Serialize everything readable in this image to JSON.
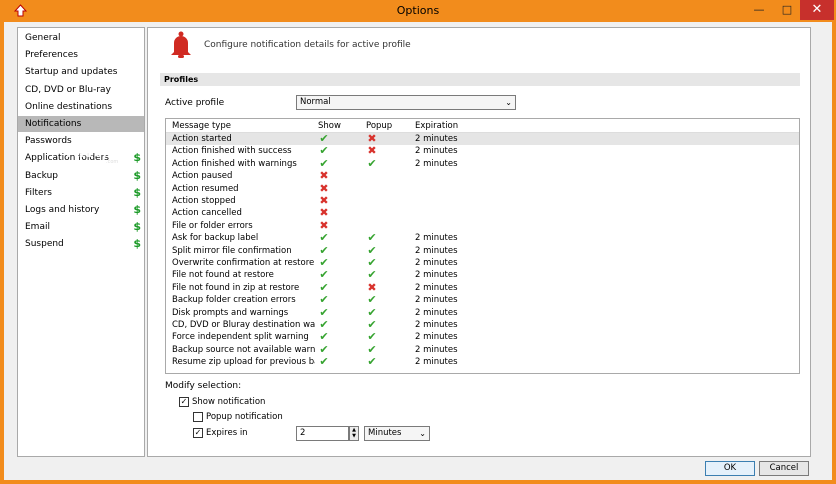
{
  "window": {
    "title": "Options",
    "min_icon": "minimize-icon",
    "max_icon": "maximize-icon",
    "close_icon": "close-icon"
  },
  "sidebar": {
    "items": [
      {
        "label": "General",
        "pro": false
      },
      {
        "label": "Preferences",
        "pro": false
      },
      {
        "label": "Startup and updates",
        "pro": false
      },
      {
        "label": "CD, DVD or Blu-ray",
        "pro": false
      },
      {
        "label": "Online destinations",
        "pro": false
      },
      {
        "label": "Notifications",
        "pro": false,
        "active": true
      },
      {
        "label": "Passwords",
        "pro": false
      },
      {
        "label": "Application folders",
        "pro": true
      },
      {
        "label": "Backup",
        "pro": true
      },
      {
        "label": "Filters",
        "pro": true
      },
      {
        "label": "Logs and history",
        "pro": true
      },
      {
        "label": "Email",
        "pro": true
      },
      {
        "label": "Suspend",
        "pro": true
      }
    ],
    "pro_marker": "$",
    "watermark": "FILECR",
    "watermark_sub": ".com"
  },
  "header": {
    "icon": "bell-icon",
    "text": "Configure notification details for active profile"
  },
  "profiles": {
    "section_label": "Profiles",
    "active_profile_label": "Active profile",
    "active_profile_value": "Normal"
  },
  "grid": {
    "columns": [
      "Message type",
      "Show",
      "Popup",
      "Expiration"
    ],
    "check_glyph": "✔",
    "cross_glyph": "✖",
    "rows": [
      {
        "type": "Action started",
        "show": true,
        "popup": false,
        "expiration": "2 minutes"
      },
      {
        "type": "Action finished with success",
        "show": true,
        "popup": false,
        "expiration": "2 minutes"
      },
      {
        "type": "Action finished with warnings",
        "show": true,
        "popup": true,
        "expiration": "2 minutes"
      },
      {
        "type": "Action paused",
        "show": false,
        "popup": null,
        "expiration": ""
      },
      {
        "type": "Action resumed",
        "show": false,
        "popup": null,
        "expiration": ""
      },
      {
        "type": "Action stopped",
        "show": false,
        "popup": null,
        "expiration": ""
      },
      {
        "type": "Action cancelled",
        "show": false,
        "popup": null,
        "expiration": ""
      },
      {
        "type": "File or folder errors",
        "show": false,
        "popup": null,
        "expiration": ""
      },
      {
        "type": "Ask for backup label",
        "show": true,
        "popup": true,
        "expiration": "2 minutes"
      },
      {
        "type": "Split mirror file confirmation",
        "show": true,
        "popup": true,
        "expiration": "2 minutes"
      },
      {
        "type": "Overwrite confirmation at restore",
        "show": true,
        "popup": true,
        "expiration": "2 minutes"
      },
      {
        "type": "File not found at restore",
        "show": true,
        "popup": true,
        "expiration": "2 minutes"
      },
      {
        "type": "File not found in zip at restore",
        "show": true,
        "popup": false,
        "expiration": "2 minutes"
      },
      {
        "type": "Backup folder creation errors",
        "show": true,
        "popup": true,
        "expiration": "2 minutes"
      },
      {
        "type": "Disk prompts and warnings",
        "show": true,
        "popup": true,
        "expiration": "2 minutes"
      },
      {
        "type": "CD, DVD or Bluray destination warni...",
        "show": true,
        "popup": true,
        "expiration": "2 minutes"
      },
      {
        "type": "Force independent split warning",
        "show": true,
        "popup": true,
        "expiration": "2 minutes"
      },
      {
        "type": "Backup source not available warning",
        "show": true,
        "popup": true,
        "expiration": "2 minutes"
      },
      {
        "type": "Resume zip upload for previous back...",
        "show": true,
        "popup": true,
        "expiration": "2 minutes"
      }
    ]
  },
  "modify": {
    "label": "Modify selection:",
    "show_notification": {
      "label": "Show notification",
      "checked": true
    },
    "popup_notification": {
      "label": "Popup notification",
      "checked": false
    },
    "expires_in": {
      "label": "Expires in",
      "checked": true,
      "value": "2",
      "unit": "Minutes"
    }
  },
  "buttons": {
    "ok": "OK",
    "cancel": "Cancel"
  },
  "colors": {
    "title_bar": "#f28c1c",
    "check": "#35a32f",
    "cross": "#d8322c",
    "pro_marker": "#1c9a28"
  }
}
